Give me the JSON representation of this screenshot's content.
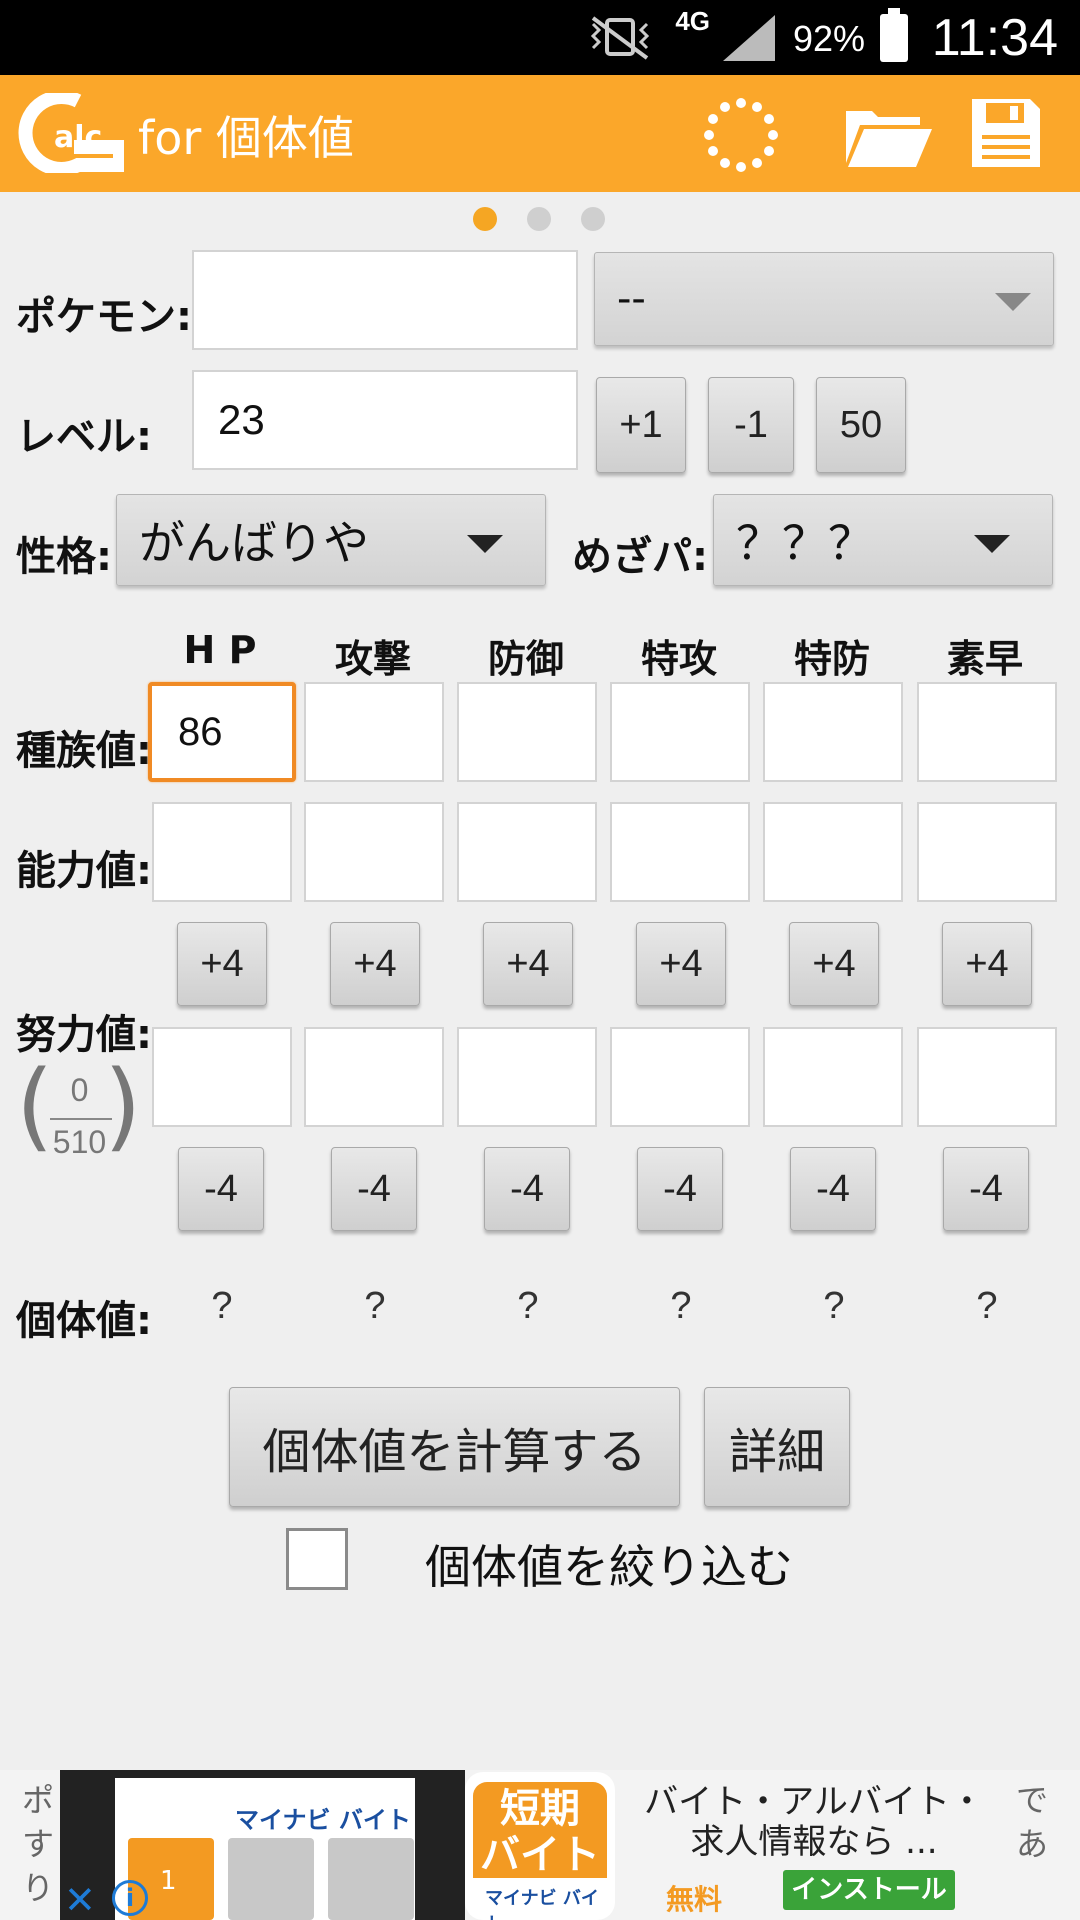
{
  "status_bar": {
    "network": "4G",
    "battery": "92%",
    "time": "11:34"
  },
  "app_bar": {
    "logo_text": "alc",
    "title": "for 個体値",
    "icons": [
      "spinner-icon",
      "folder-icon",
      "save-icon"
    ],
    "color": "#fba72a"
  },
  "pager": {
    "pages": 3,
    "current": 1
  },
  "pokemon": {
    "label": "ポケモン:",
    "name_value": "",
    "form_value": "--"
  },
  "level": {
    "label": "レベル:",
    "value": "23",
    "buttons": [
      "+1",
      "-1",
      "50"
    ]
  },
  "nature": {
    "label": "性格:",
    "value": "がんばりや"
  },
  "hidden_power": {
    "label": "めざパ:",
    "value": "？？？"
  },
  "stats": {
    "headers": [
      "H P",
      "攻撃",
      "防御",
      "特攻",
      "特防",
      "素早"
    ],
    "base_label": "種族値:",
    "base_values": [
      "86",
      "",
      "",
      "",
      "",
      ""
    ],
    "actual_label": "能力値:",
    "actual_values": [
      "",
      "",
      "",
      "",
      "",
      ""
    ],
    "ev_label": "努力値:",
    "ev_values": [
      "",
      "",
      "",
      "",
      "",
      ""
    ],
    "ev_plus": "+4",
    "ev_minus": "-4",
    "ev_total": "0",
    "ev_max": "510",
    "iv_label": "個体値:",
    "iv_values": [
      "?",
      "?",
      "?",
      "?",
      "?",
      "?"
    ]
  },
  "actions": {
    "calculate": "個体値を計算する",
    "details": "詳細",
    "filter_label": "個体値を絞り込む",
    "filter_checked": false
  },
  "ad": {
    "left_text": "ポ\nす\nり",
    "right_text": "で\nあ",
    "banner_logo": "マイナビ バイト",
    "tile_number": "1",
    "icon_top": "短期\nバイト",
    "icon_bottom": "マイナビ バイト",
    "headline": "バイト・アルバイト・求人情報なら ...",
    "price": "無料",
    "install": "インストール",
    "accent": "#f39a22",
    "install_color": "#3aa339"
  }
}
